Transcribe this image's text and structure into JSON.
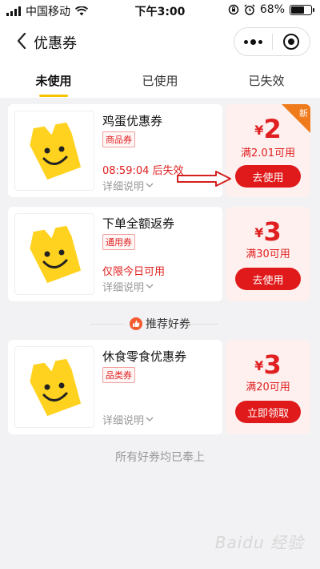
{
  "status_bar": {
    "carrier": "中国移动",
    "time": "下午3:00",
    "battery": "68%",
    "battery_level": 0.68
  },
  "navbar": {
    "title": "优惠券"
  },
  "tabs": [
    {
      "label": "未使用",
      "active": true
    },
    {
      "label": "已使用",
      "active": false
    },
    {
      "label": "已失效",
      "active": false
    }
  ],
  "coupons": [
    {
      "name": "鸡蛋优惠券",
      "tag": "商品券",
      "info": "08:59:04 后失效",
      "detail": "详细说明",
      "currency": "¥",
      "amount": "2",
      "condition": "满2.01可用",
      "button": "去使用",
      "badge": "新"
    },
    {
      "name": "下单全额返券",
      "tag": "通用券",
      "info": "仅限今日可用",
      "detail": "详细说明",
      "currency": "¥",
      "amount": "3",
      "condition": "满30可用",
      "button": "去使用"
    }
  ],
  "recommend": {
    "title": "推荐好券"
  },
  "recommended_coupon": {
    "name": "休食零食优惠券",
    "tag": "品类券",
    "detail": "详细说明",
    "currency": "¥",
    "amount": "3",
    "condition": "满20可用",
    "button": "立即领取"
  },
  "footer": "所有好券均已奉上",
  "watermark": "Baidu 经验",
  "colors": {
    "accent_red": "#e01a1a",
    "tab_indicator": "#f6c500",
    "new_badge": "#f07b1d",
    "price_bg": "#fdf0ef"
  }
}
